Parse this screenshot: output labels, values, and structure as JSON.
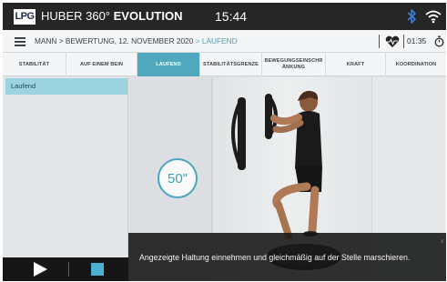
{
  "app": {
    "logo_text": "LPG",
    "brand_light": "HUBER 360°",
    "brand_bold": "EVOLUTION",
    "time": "15:44"
  },
  "icons": {
    "bluetooth": "bluetooth-icon",
    "wifi": "wifi-icon",
    "menu": "hamburger-menu-icon",
    "heart": "heart-rate-icon",
    "stopwatch": "stopwatch-icon",
    "play": "play-icon",
    "stop": "stop-icon"
  },
  "breadcrumb": {
    "path": "MANN > BEWERTUNG, 12. NOVEMBER 2020",
    "separator": " > ",
    "current": "LAUFEND"
  },
  "session": {
    "elapsed": "01:35"
  },
  "tabs": [
    {
      "label": "STABILITÄT"
    },
    {
      "label": "AUF EINEM BEIN"
    },
    {
      "label": "LAUFEND"
    },
    {
      "label": "STABILITÄTSGRENZE"
    },
    {
      "label": "BEWEGUNGSEINSCHR ÄNKUNG"
    },
    {
      "label": "KRAFT"
    },
    {
      "label": "KOORDINATION"
    }
  ],
  "active_tab": "LAUFEND",
  "exercise_list": [
    {
      "label": "Laufend",
      "selected": true
    }
  ],
  "exercise": {
    "countdown": "50\"",
    "instruction": "Angezeigte Haltung einnehmen und gleichmäßig auf der Stelle marschieren.",
    "close": "x"
  },
  "colors": {
    "accent": "#4fa8bd",
    "topbar": "#262626",
    "selected_item": "#9bd3e0",
    "stop_button": "#47b1d0"
  }
}
